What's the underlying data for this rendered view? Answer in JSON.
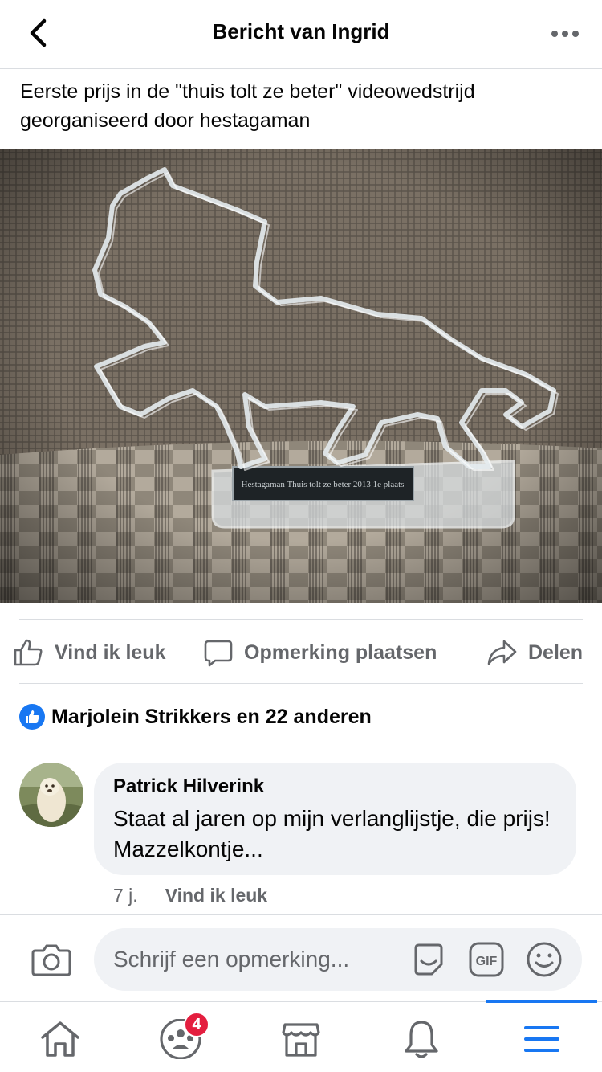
{
  "header": {
    "title": "Bericht van Ingrid",
    "back_icon": "chevron-left-icon",
    "more_icon": "more-horizontal-icon"
  },
  "post": {
    "text": "Eerste prijs in de \"thuis tolt ze beter\" videowedstrijd georganiseerd door hestagaman",
    "photo_alt": "photo",
    "plaque_text": "Hestagaman Thuis tolt ze beter 2013 1e plaats"
  },
  "actions": {
    "like_label": "Vind ik leuk",
    "comment_label": "Opmerking plaatsen",
    "share_label": "Delen"
  },
  "reactions": {
    "summary": "Marjolein Strikkers en 22 anderen"
  },
  "comments": [
    {
      "author": "Patrick Hilverink",
      "text": "Staat al jaren op mijn verlanglijstje, die prijs! Mazzelkontje...",
      "time": "7 j.",
      "like_label": "Vind ik leuk"
    }
  ],
  "composer": {
    "placeholder": "Schrijf een opmerking..."
  },
  "bottom_nav": {
    "items": [
      {
        "icon": "home-icon"
      },
      {
        "icon": "groups-icon",
        "badge": "4"
      },
      {
        "icon": "marketplace-icon"
      },
      {
        "icon": "notifications-bell-icon"
      },
      {
        "icon": "menu-icon",
        "active": true
      }
    ]
  },
  "colors": {
    "accent": "#1877f2",
    "secondary_text": "#65676b",
    "bubble_bg": "#f0f2f5",
    "badge_red": "#e41e3f"
  }
}
